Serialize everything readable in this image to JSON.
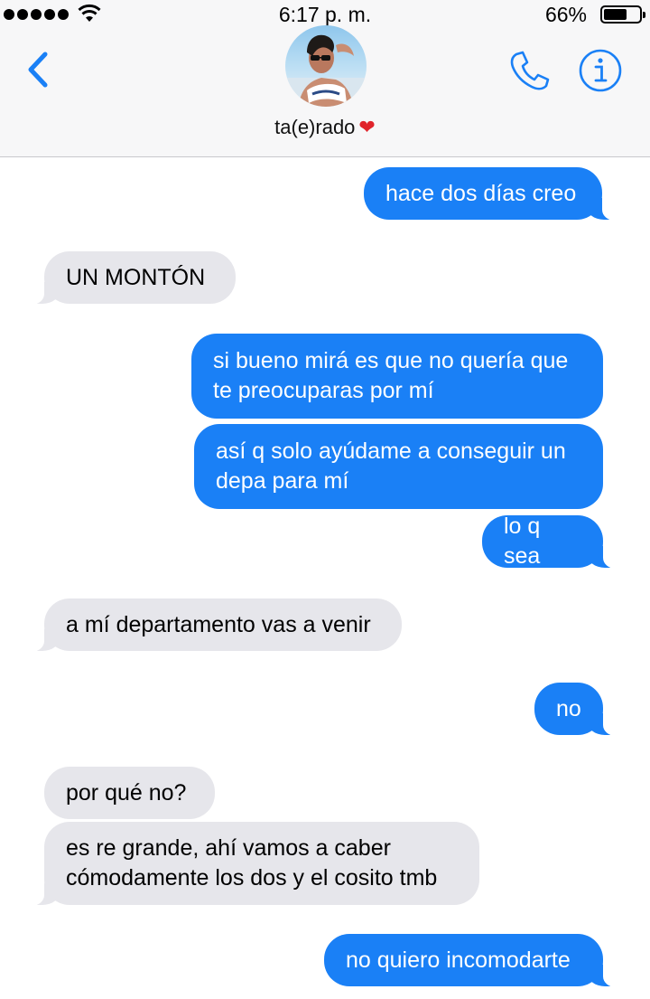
{
  "status_bar": {
    "time": "6:17 p. m.",
    "battery_percent": "66%",
    "battery_level": 0.66,
    "signal_bars": 5
  },
  "header": {
    "contact_name": "ta(e)rado",
    "contact_emoji": "❤️",
    "icons": [
      "back-chevron-icon",
      "phone-icon",
      "info-icon"
    ],
    "accent_color": "#1a80f6"
  },
  "messages": [
    {
      "sender": "me",
      "text": "hace dos días creo"
    },
    {
      "sender": "them",
      "text": "UN MONTÓN"
    },
    {
      "sender": "me",
      "text": "si bueno mirá es que no quería que te preocuparas por mí"
    },
    {
      "sender": "me",
      "text": "así q solo ayúdame a conseguir un depa para mí"
    },
    {
      "sender": "me",
      "text": "lo q sea"
    },
    {
      "sender": "them",
      "text": "a mí departamento vas a venir"
    },
    {
      "sender": "me",
      "text": "no"
    },
    {
      "sender": "them",
      "text": "por qué no?"
    },
    {
      "sender": "them",
      "text": "es re grande, ahí vamos a caber cómodamente los dos y el cosito tmb"
    },
    {
      "sender": "me",
      "text": "no quiero incomodarte"
    }
  ],
  "colors": {
    "sent_bubble": "#1a80f6",
    "received_bubble": "#e6e6eb",
    "header_bg": "#f7f7f8"
  }
}
